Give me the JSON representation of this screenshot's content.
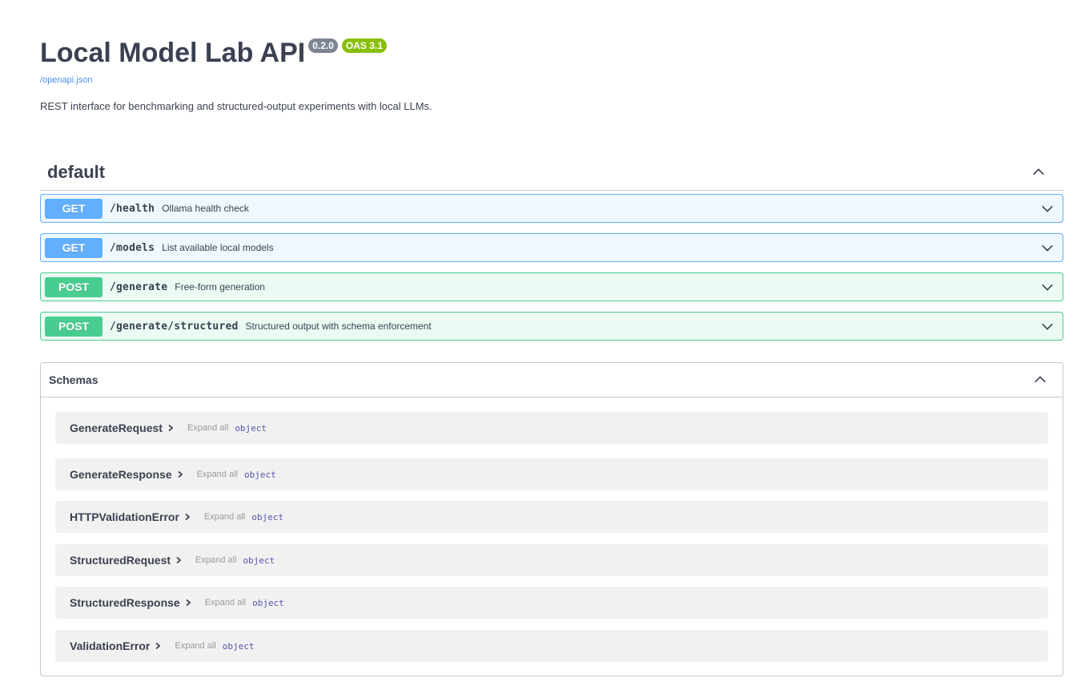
{
  "info": {
    "title": "Local Model Lab API",
    "version": "0.2.0",
    "oas": "OAS 3.1",
    "spec_link": "/openapi.json",
    "description": "REST interface for benchmarking and structured-output experiments with local LLMs."
  },
  "tag": {
    "name": "default",
    "chevron": "chevron-up-icon"
  },
  "operations": [
    {
      "method": "GET",
      "path": "/health",
      "summary": "Ollama health check",
      "color": "#61affe"
    },
    {
      "method": "GET",
      "path": "/models",
      "summary": "List available local models",
      "color": "#61affe"
    },
    {
      "method": "POST",
      "path": "/generate",
      "summary": "Free-form generation",
      "color": "#49cc90"
    },
    {
      "method": "POST",
      "path": "/generate/structured",
      "summary": "Structured output with schema enforcement",
      "color": "#49cc90"
    }
  ],
  "schemas": {
    "title": "Schemas",
    "items": [
      {
        "name": "GenerateRequest",
        "expand": "Expand all",
        "type": "object"
      },
      {
        "name": "GenerateResponse",
        "expand": "Expand all",
        "type": "object"
      },
      {
        "name": "HTTPValidationError",
        "expand": "Expand all",
        "type": "object"
      },
      {
        "name": "StructuredRequest",
        "expand": "Expand all",
        "type": "object"
      },
      {
        "name": "StructuredResponse",
        "expand": "Expand all",
        "type": "object"
      },
      {
        "name": "ValidationError",
        "expand": "Expand all",
        "type": "object"
      }
    ]
  }
}
